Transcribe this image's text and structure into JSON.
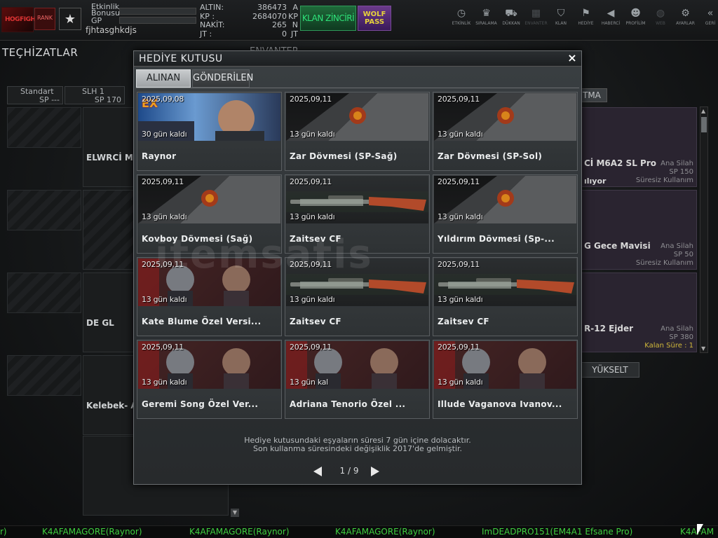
{
  "topbar": {
    "logo_text": "HOGFIGHT",
    "badge_text": "RANK",
    "etkinlik_label": "Etkinlik",
    "bonus_label": "Bonusu",
    "gp_label": "GP",
    "username": "fjhtasghkdjs",
    "currencies": [
      {
        "label": "ALTIN:",
        "value": "386473",
        "unit": "A"
      },
      {
        "label": "KP  :",
        "value": "2684070",
        "unit": "KP"
      },
      {
        "label": "NAKİT:",
        "value": "265",
        "unit": "N"
      },
      {
        "label": "JT  :",
        "value": "0",
        "unit": "JT"
      }
    ],
    "clan_chain_label": "KLAN ZİNCİRİ",
    "wolf_pass_line1": "WOLF",
    "wolf_pass_line2": "PASS",
    "nav": [
      {
        "label": "ETKİNLİK",
        "icon": "clock-icon"
      },
      {
        "label": "SIRALAMA",
        "icon": "ranking-icon"
      },
      {
        "label": "DÜKKAN",
        "icon": "cart-icon"
      },
      {
        "label": "ENVANTER",
        "icon": "inventory-icon"
      },
      {
        "label": "KLAN",
        "icon": "clan-shield-icon"
      },
      {
        "label": "HEDİYE",
        "icon": "gift-icon"
      },
      {
        "label": "HABERCİ",
        "icon": "megaphone-icon"
      },
      {
        "label": "PROFİLİM",
        "icon": "profile-icon"
      },
      {
        "label": "WEB",
        "icon": "web-icon"
      },
      {
        "label": "AYARLAR",
        "icon": "gear-icon"
      },
      {
        "label": "GERİ",
        "icon": "back-icon"
      }
    ]
  },
  "background": {
    "section_title": "TEÇHİZATLAR",
    "inventory_title": "ENVANTER",
    "left_tabs": [
      {
        "line1": "Standart",
        "line2": "SP ---"
      },
      {
        "line1": "SLH 1",
        "line2": "SP 170"
      }
    ],
    "weapons": [
      "ELWRCİ M",
      "",
      "DE GL",
      "Kelebek- A"
    ],
    "right_tab": "TMA",
    "right_items": [
      {
        "name": "Cİ M6A2 SL Pro",
        "type": "Ana Silah",
        "sp": "SP 150",
        "status_left": "ılıyor",
        "status_right": "Süresiz Kullanım"
      },
      {
        "name": "G Gece Mavisi",
        "type": "Ana Silah",
        "sp": "SP 50",
        "status_left": "",
        "status_right": "Süresiz Kullanım"
      },
      {
        "name": "R-12 Ejder",
        "type": "Ana Silah",
        "sp": "SP 380",
        "status_left": "",
        "status_right": "Kalan Süre : 1"
      }
    ],
    "upgrade_label": "YÜKSELT"
  },
  "dialog": {
    "title": "HEDİYE KUTUSU",
    "close_symbol": "×",
    "tabs": [
      "ALINAN",
      "GÖNDERİLEN"
    ],
    "items": [
      {
        "date": "2025,09,08",
        "left": "30 gün kaldı",
        "name": "Raynor",
        "kind": "raynor",
        "badge": "EX"
      },
      {
        "date": "2025,09,11",
        "left": "13 gün kaldı",
        "name": "Zar Dövmesi (SP-Sağ)",
        "kind": "dark",
        "badge": ""
      },
      {
        "date": "2025,09,11",
        "left": "13 gün kaldı",
        "name": "Zar Dövmesi (SP-Sol)",
        "kind": "dark",
        "badge": ""
      },
      {
        "date": "2025,09,11",
        "left": "13 gün kaldı",
        "name": "Kovboy Dövmesi (Sağ)",
        "kind": "dark",
        "badge": ""
      },
      {
        "date": "2025,09,11",
        "left": "13 gün kaldı",
        "name": "Zaitsev CF",
        "kind": "gun",
        "badge": ""
      },
      {
        "date": "2025,09,11",
        "left": "13 gün kaldı",
        "name": "Yıldırım Dövmesi (Sp-...",
        "kind": "dark",
        "badge": ""
      },
      {
        "date": "2025,09,11",
        "left": "13 gün kaldı",
        "name": "Kate Blume Özel Versi...",
        "kind": "char",
        "badge": ""
      },
      {
        "date": "2025,09,11",
        "left": "13 gün kaldı",
        "name": "Zaitsev CF",
        "kind": "gun",
        "badge": ""
      },
      {
        "date": "2025,09,11",
        "left": "13 gün kaldı",
        "name": "Zaitsev CF",
        "kind": "gun",
        "badge": ""
      },
      {
        "date": "2025,09,11",
        "left": "13 gün kaldı",
        "name": "Geremi Song Özel Ver...",
        "kind": "char",
        "badge": ""
      },
      {
        "date": "2025,09,11",
        "left": "13 gün kal",
        "name": "Adriana Tenorio Özel ...",
        "kind": "char",
        "badge": ""
      },
      {
        "date": "2025,09,11",
        "left": "13 gün kaldı",
        "name": "Illude Vaganova Ivanov...",
        "kind": "char",
        "badge": ""
      }
    ],
    "note_line1": "Hediye kutusundaki eşyaların süresi 7 gün içine dolacaktır.",
    "note_line2": "Son kullanma süresindeki değişiklik 2017'de gelmiştir.",
    "page_current": 1,
    "page_total": 9,
    "page_text": "1 / 9",
    "watermark": "itemsatis"
  },
  "ticker": [
    "r)",
    "K4AFAMAGORE(Raynor)",
    "K4AFAMAGORE(Raynor)",
    "K4AFAMAGORE(Raynor)",
    "ImDEADPRO151(EM4A1 Efsane Pro)",
    "K4AFAM"
  ]
}
